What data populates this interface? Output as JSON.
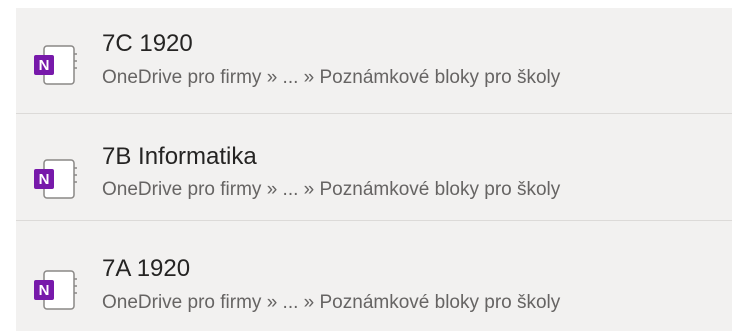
{
  "notebooks": [
    {
      "title": "7C 1920",
      "path": "OneDrive pro firmy » ... » Poznámkové bloky pro školy",
      "icon": "onenote-notebook-icon"
    },
    {
      "title": "7B Informatika",
      "path": "OneDrive pro firmy » ... » Poznámkové bloky pro školy",
      "icon": "onenote-notebook-icon"
    },
    {
      "title": "7A 1920",
      "path": "OneDrive pro firmy » ... » Poznámkové bloky pro školy",
      "icon": "onenote-notebook-icon"
    }
  ],
  "colors": {
    "onenote_purple": "#7719aa",
    "list_background": "#f2f1f0",
    "title_text": "#252423",
    "path_text": "#666463"
  }
}
